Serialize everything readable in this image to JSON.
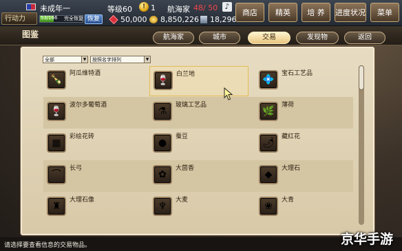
{
  "topbar": {
    "player_name": "未成年一",
    "level": "等级60",
    "coin_count": "1",
    "career": "航海家",
    "hp": "48/ 50",
    "action_label": "行动力",
    "stamina": "53/166",
    "stamina_state": "完全恢复",
    "restore_label": "恢复",
    "stamina_fraction": 0.32,
    "gems": "50,000",
    "gold": "8,850,226",
    "ducats": "18,296",
    "buttons": [
      "商店",
      "精英",
      "培 养",
      "进度状况",
      "菜单"
    ],
    "hp_color": "#f3474a"
  },
  "header": {
    "title": "图鉴",
    "tabs": [
      "航海家",
      "城市",
      "交易",
      "发现物",
      "返回"
    ],
    "active_tab": "交易"
  },
  "filters": {
    "category": "全部",
    "sort": "按照名字排列"
  },
  "items": [
    [
      {
        "name": "阿瓜维特酒",
        "icon": "bottle-icon",
        "glyph": "🍾"
      },
      {
        "name": "白兰地",
        "icon": "brandy-icon",
        "glyph": "🍷",
        "selected": true
      },
      {
        "name": "宝石工艺品",
        "icon": "jewel-craft-icon",
        "glyph": "💠"
      }
    ],
    [
      {
        "name": "波尔多葡萄酒",
        "icon": "wine-icon",
        "glyph": "🍷"
      },
      {
        "name": "玻璃工艺品",
        "icon": "glassware-icon",
        "glyph": "⚗"
      },
      {
        "name": "薄荷",
        "icon": "mint-icon",
        "glyph": "🌿"
      }
    ],
    [
      {
        "name": "彩绘花砖",
        "icon": "tile-icon",
        "glyph": "▦"
      },
      {
        "name": "蚕豆",
        "icon": "beans-icon",
        "glyph": "●"
      },
      {
        "name": "藏红花",
        "icon": "saffron-icon",
        "glyph": "🌶"
      }
    ],
    [
      {
        "name": "长弓",
        "icon": "longbow-icon",
        "glyph": "⌒"
      },
      {
        "name": "大茴香",
        "icon": "anise-icon",
        "glyph": "✿"
      },
      {
        "name": "大理石",
        "icon": "marble-icon",
        "glyph": "◆"
      }
    ],
    [
      {
        "name": "大理石像",
        "icon": "statue-icon",
        "glyph": "♜"
      },
      {
        "name": "大麦",
        "icon": "barley-icon",
        "glyph": "♆"
      },
      {
        "name": "大青",
        "icon": "woad-icon",
        "glyph": "❀"
      }
    ]
  ],
  "footer": {
    "hint": "请选择要查看信息的交易物品。",
    "watermark": "京华手游"
  }
}
